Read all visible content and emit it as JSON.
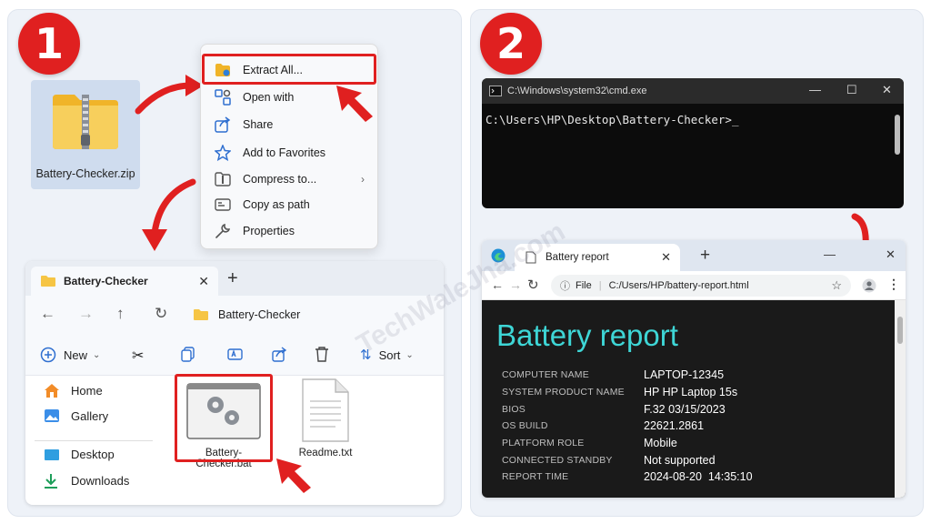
{
  "steps": {
    "one": "1",
    "two": "2"
  },
  "zip": {
    "label": "Battery-Checker.zip"
  },
  "context_menu": {
    "items": [
      {
        "label": "Extract All...",
        "icon": "extract-folder-icon"
      },
      {
        "label": "Open with",
        "icon": "open-with-icon"
      },
      {
        "label": "Share",
        "icon": "share-icon"
      },
      {
        "label": "Add to Favorites",
        "icon": "star-icon"
      },
      {
        "label": "Compress to...",
        "icon": "compress-icon"
      },
      {
        "label": "Copy as path",
        "icon": "copy-path-icon"
      },
      {
        "label": "Properties",
        "icon": "wrench-icon"
      }
    ]
  },
  "explorer": {
    "tab_title": "Battery-Checker",
    "path": "Battery-Checker",
    "toolbar": {
      "new_label": "New",
      "sort_label": "Sort"
    },
    "sidebar": [
      {
        "label": "Home",
        "icon": "home-icon"
      },
      {
        "label": "Gallery",
        "icon": "gallery-icon"
      },
      {
        "label": "Desktop",
        "icon": "desktop-icon"
      },
      {
        "label": "Downloads",
        "icon": "download-icon"
      }
    ],
    "files": [
      {
        "label": "Battery-Checker.bat",
        "icon": "bat-file-icon"
      },
      {
        "label": "Readme.txt",
        "icon": "text-file-icon"
      }
    ]
  },
  "cmd": {
    "title": "C:\\Windows\\system32\\cmd.exe",
    "prompt": "C:\\Users\\HP\\Desktop\\Battery-Checker>"
  },
  "browser": {
    "tab_title": "Battery report",
    "url_scheme": "File",
    "url": "C:/Users/HP/battery-report.html",
    "report": {
      "title": "Battery report",
      "rows": [
        {
          "label": "COMPUTER NAME",
          "value": "LAPTOP-12345"
        },
        {
          "label": "SYSTEM PRODUCT NAME",
          "value": "HP HP Laptop 15s"
        },
        {
          "label": "BIOS",
          "value": "F.32 03/15/2023"
        },
        {
          "label": "OS BUILD",
          "value": "22621.2861"
        },
        {
          "label": "PLATFORM ROLE",
          "value": "Mobile"
        },
        {
          "label": "CONNECTED STANDBY",
          "value": "Not supported"
        },
        {
          "label": "REPORT TIME",
          "value": "2024-08-20  14:35:10"
        }
      ]
    }
  },
  "watermark": "TechWaleJha.com",
  "colors": {
    "accent_red": "#e02020",
    "report_title": "#3ed6d6",
    "folder_yellow": "#f6c544"
  }
}
